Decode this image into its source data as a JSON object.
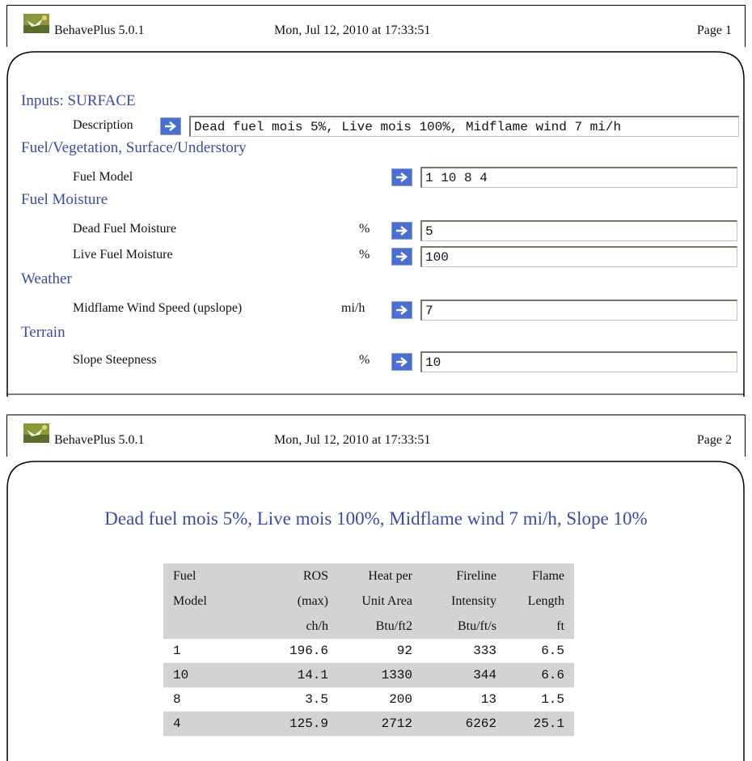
{
  "page1": {
    "header": {
      "app": "BehavePlus 5.0.1",
      "datetime": "Mon, Jul 12, 2010 at 17:33:51",
      "page": "Page 1"
    },
    "sections": {
      "inputs": "Inputs: SURFACE",
      "fuel": "Fuel/Vegetation, Surface/Understory",
      "moisture": "Fuel Moisture",
      "weather": "Weather",
      "terrain": "Terrain"
    },
    "rows": {
      "description": {
        "label": "Description",
        "value": "Dead fuel mois 5%, Live mois 100%, Midflame wind 7 mi/h"
      },
      "fuel_model": {
        "label": "Fuel Model",
        "unit": "",
        "value": "1 10 8 4"
      },
      "dead_moisture": {
        "label": "Dead Fuel Moisture",
        "unit": "%",
        "value": "5"
      },
      "live_moisture": {
        "label": "Live Fuel Moisture",
        "unit": "%",
        "value": "100"
      },
      "wind": {
        "label": "Midflame Wind Speed (upslope)",
        "unit": "mi/h",
        "value": "7"
      },
      "slope": {
        "label": "Slope Steepness",
        "unit": "%",
        "value": "10"
      }
    }
  },
  "page2": {
    "header": {
      "app": "BehavePlus 5.0.1",
      "datetime": "Mon, Jul 12, 2010 at 17:33:51",
      "page": "Page 2"
    },
    "title": "Dead fuel mois 5%, Live mois 100%, Midflame wind 7 mi/h, Slope 10%",
    "table": {
      "header_rows": [
        [
          "Fuel",
          "ROS",
          "Heat per",
          "Fireline",
          "Flame"
        ],
        [
          "Model",
          "(max)",
          "Unit Area",
          "Intensity",
          "Length"
        ],
        [
          "",
          "ch/h",
          "Btu/ft2",
          "Btu/ft/s",
          "ft"
        ]
      ],
      "rows": [
        [
          "1",
          "196.6",
          "92",
          "333",
          "6.5"
        ],
        [
          "10",
          "14.1",
          "1330",
          "344",
          "6.6"
        ],
        [
          "8",
          "3.5",
          "200",
          "13",
          "1.5"
        ],
        [
          "4",
          "125.9",
          "2712",
          "6262",
          "25.1"
        ]
      ]
    }
  },
  "colors": {
    "heading": "#3b4aa5",
    "arrow": "#4a6fd0",
    "table_shade": "#d3d3d3"
  },
  "icons": {
    "app": "behaveplus-logo-icon",
    "go": "arrow-right-icon"
  }
}
